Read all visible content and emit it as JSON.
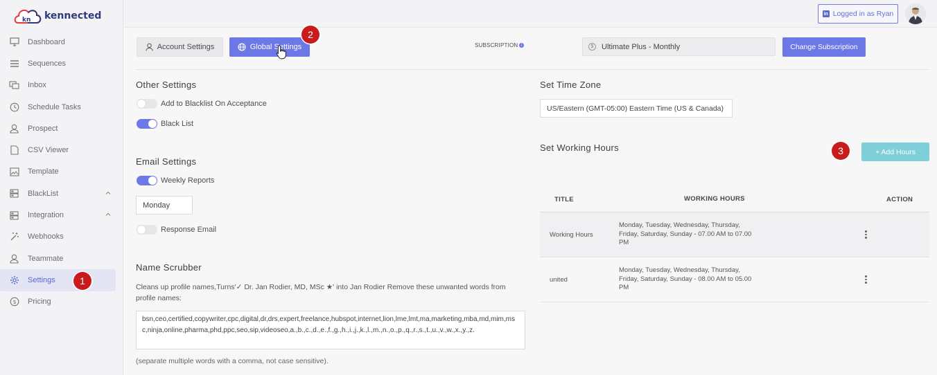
{
  "brand": {
    "logo_mark": "kn",
    "name": "kennected"
  },
  "sidebar": {
    "items": [
      {
        "label": "Dashboard",
        "icon": "monitor-icon"
      },
      {
        "label": "Sequences",
        "icon": "list-icon"
      },
      {
        "label": "Inbox",
        "icon": "chat-icon"
      },
      {
        "label": "Schedule Tasks",
        "icon": "clock-icon"
      },
      {
        "label": "Prospect",
        "icon": "user-icon"
      },
      {
        "label": "CSV Viewer",
        "icon": "file-icon"
      },
      {
        "label": "Template",
        "icon": "image-icon"
      },
      {
        "label": "BlackList",
        "icon": "server-icon"
      },
      {
        "label": "Integration",
        "icon": "server-icon"
      },
      {
        "label": "Webhooks",
        "icon": "magic-wand-icon"
      },
      {
        "label": "Teammate",
        "icon": "user-icon"
      },
      {
        "label": "Settings",
        "icon": "gear-icon"
      },
      {
        "label": "Pricing",
        "icon": "dollar-icon"
      }
    ]
  },
  "header": {
    "logged_in_label": "Logged in as Ryan"
  },
  "tabs": {
    "account_settings": "Account Settings",
    "global_settings": "Global Settings"
  },
  "subscription": {
    "label": "SUBSCRIPTION",
    "plan": "Ultimate Plus - Monthly",
    "change_button": "Change Subscription"
  },
  "other_settings": {
    "title": "Other Settings",
    "add_blacklist_label": "Add to Blacklist On Acceptance",
    "add_blacklist_on": false,
    "black_list_label": "Black List",
    "black_list_on": true
  },
  "email_settings": {
    "title": "Email Settings",
    "weekly_reports_label": "Weekly Reports",
    "weekly_reports_on": true,
    "day": "Monday",
    "response_email_label": "Response Email",
    "response_email_on": false
  },
  "name_scrubber": {
    "title": "Name Scrubber",
    "description": "Cleans up profile names,Turns'✓ Dr. Jan Rodier, MD, MSc ★' into Jan Rodier Remove these unwanted words from profile names:",
    "words": "bsn,ceo,certified,copywriter,cpc,digital,dr,drs,expert,freelance,hubspot,internet,lion,lme,lmt,ma,marketing,mba,md,mim,msc,ninja,online,pharma,phd,ppc,seo,sip,videoseo,a.,b.,c.,d.,e.,f.,g.,h.,i.,j.,k.,l.,m.,n.,o.,p.,q.,r.,s.,t.,u.,v.,w.,x.,y.,z.",
    "hint": "(separate multiple words with a comma, not case sensitive)."
  },
  "time_zone": {
    "title": "Set Time Zone",
    "value": "US/Eastern (GMT-05:00) Eastern Time (US & Canada)"
  },
  "working_hours": {
    "title": "Set Working Hours",
    "add_button": "+ Add Hours",
    "columns": [
      "TITLE",
      "WORKING HOURS",
      "ACTION"
    ],
    "rows": [
      {
        "title": "Working Hours",
        "hours": "Monday, Tuesday, Wednesday, Thursday, Friday, Saturday, Sunday - 07.00 AM to 07.00 PM"
      },
      {
        "title": "united",
        "hours": "Monday, Tuesday, Wednesday, Thursday, Friday, Saturday, Sunday - 08.00 AM to 05.00 PM"
      }
    ]
  },
  "annotations": {
    "badge_1": "1",
    "badge_2": "2",
    "badge_3": "3"
  },
  "colors": {
    "accent": "#6b78e5",
    "add_button": "#7fcfda",
    "badge": "#c81b1b",
    "brand": "#2f3a7d"
  }
}
